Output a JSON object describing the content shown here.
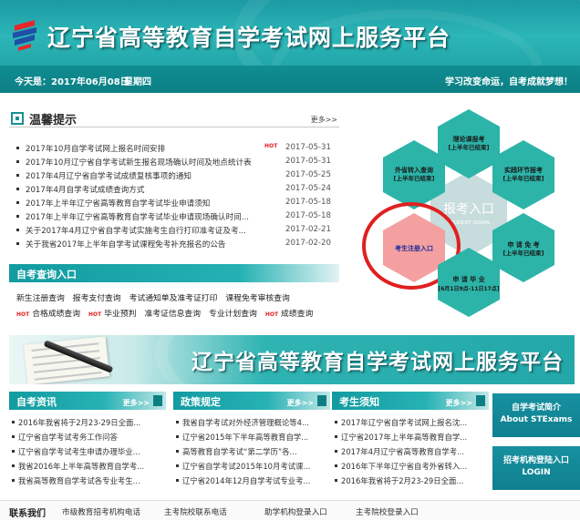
{
  "header": {
    "site_title": "辽宁省高等教育自学考试网上服务平台",
    "date_label": "今天是：2017年06月08日",
    "weekday": "星期四",
    "slogan": "学习改变命运，自考成就梦想！"
  },
  "notice": {
    "title": "温馨提示",
    "more": "更多>>",
    "items": [
      {
        "text": "2017年10月自学考试网上报名时间安排",
        "hot": "HOT",
        "date": "2017-05-31"
      },
      {
        "text": "2017年10月辽宁省自学考试新生报名现场确认时间及地点统计表",
        "hot": "",
        "date": "2017-05-31"
      },
      {
        "text": "2017年4月辽宁省自学考试成绩复核事项的通知",
        "hot": "",
        "date": "2017-05-25"
      },
      {
        "text": "2017年4月自学考试成绩查询方式",
        "hot": "",
        "date": "2017-05-24"
      },
      {
        "text": "2017年上半年辽宁省高等教育自学考试毕业申请须知",
        "hot": "",
        "date": "2017-05-18"
      },
      {
        "text": "2017年上半年辽宁省高等教育自学考试毕业申请现场确认时间...",
        "hot": "",
        "date": "2017-05-18"
      },
      {
        "text": "关于2017年4月辽宁省自学考试实施考生自行打印准考证及考...",
        "hot": "",
        "date": "2017-02-21"
      },
      {
        "text": "关于我省2017年上半年自学考试课程免考补充报名的公告",
        "hot": "",
        "date": "2017-02-20"
      }
    ]
  },
  "query": {
    "title": "自考查询入口",
    "row1": [
      "新生注册查询",
      "报考支付查询",
      "考试通知单及准考证打印",
      "课程免考审核查询"
    ],
    "row2": [
      {
        "hot": "HOT",
        "text": "合格成绩查询"
      },
      {
        "hot": "HOT",
        "text": "毕业预判"
      },
      {
        "hot": "",
        "text": "准考证信息查询"
      },
      {
        "hot": "",
        "text": "专业计划查询"
      },
      {
        "hot": "HOT",
        "text": "成绩查询"
      }
    ]
  },
  "hexes": {
    "center_title": "报考入口",
    "center_sub": "STUDENT SIGNIN",
    "top": {
      "title": "理论课报考",
      "sub": "[上半年已结束]"
    },
    "upper_left": {
      "title": "外省转入查询",
      "sub": "[上半年已结束]"
    },
    "upper_right": {
      "title": "实践环节报考",
      "sub": "[上半年已结束]"
    },
    "lower_left": {
      "title": "考生注册入口",
      "sub": ""
    },
    "lower_right": {
      "title": "申 请 免 考",
      "sub": "[上半年已结束]"
    },
    "bottom": {
      "title": "申 请 毕 业",
      "sub": "[6月1日9点-11日17点]"
    },
    "colors": {
      "teal": "#2cb4a8",
      "light": "#c7dcdc",
      "pink": "#f4a0a0",
      "ring": "#e02020"
    }
  },
  "banner": {
    "title": "辽宁省高等教育自学考试网上服务平台"
  },
  "columns": [
    {
      "title": "自考资讯",
      "more": "更多>>",
      "items": [
        "2016年我省将于2月23-29日全面...",
        "辽宁省自学考试考务工作问答",
        "辽宁省自学考试考生申请办理毕业...",
        "我省2016年上半年高等教育自学考...",
        "我省高等教育自学考试各专业考生..."
      ]
    },
    {
      "title": "政策规定",
      "more": "更多>>",
      "items": [
        "我省自学考试对外经济管理概论等4...",
        "辽宁省2015年下半年高等教育自学...",
        "高等教育自学考试“第二学历”各...",
        "辽宁省自学考试2015年10月考试课...",
        "辽宁省2014年12月自学考试专业考..."
      ]
    },
    {
      "title": "考生须知",
      "more": "更多>>",
      "items": [
        "2017年辽宁省自学考试网上报名沈...",
        "辽宁省2017年上半年高等教育自学...",
        "2017年4月辽宁省高等教育自学考...",
        "2016年下半年辽宁省自考外省转入...",
        "2016年我省将于2月23-29日全面..."
      ]
    }
  ],
  "side_buttons": [
    {
      "cn": "自学考试简介",
      "en": "About STExams"
    },
    {
      "cn": "招考机构登陆入口",
      "en": "LOGIN"
    }
  ],
  "footer": {
    "label": "联系我们",
    "links": [
      "市级教育招考机构电话",
      "主考院校联系电话",
      "助学机构登录入口",
      "主考院校登录入口"
    ]
  }
}
